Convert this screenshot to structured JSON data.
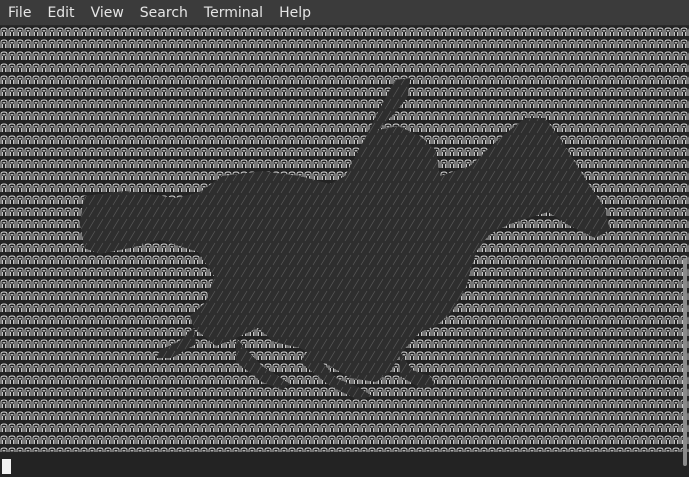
{
  "menubar": {
    "items": [
      {
        "label": "File"
      },
      {
        "label": "Edit"
      },
      {
        "label": "View"
      },
      {
        "label": "Search"
      },
      {
        "label": "Terminal"
      },
      {
        "label": "Help"
      }
    ]
  },
  "terminal": {
    "content": "ascii-art-horse-and-rider",
    "colors": {
      "background": "#232323",
      "text_light": "#d9d9d9",
      "silhouette": "#2e2e2e",
      "menubar": "#3b3b3b",
      "cursor": "#f2f2f2"
    }
  }
}
